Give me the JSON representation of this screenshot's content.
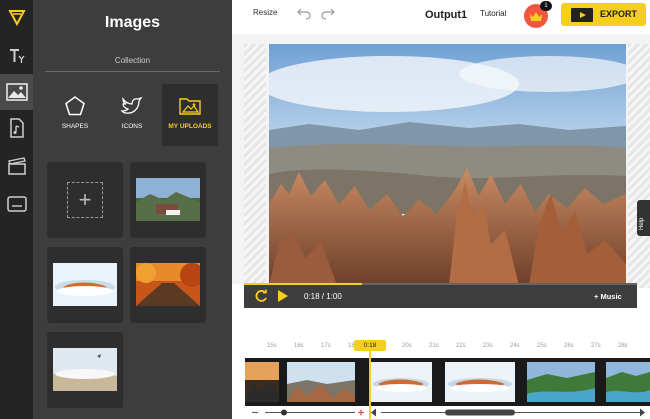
{
  "panel": {
    "title": "Images",
    "subtitle": "Collection",
    "categories": [
      {
        "label": "SHAPES"
      },
      {
        "label": "ICONS"
      },
      {
        "label": "MY UPLOADS"
      }
    ]
  },
  "topbar": {
    "resize": "Resize",
    "project": "Output1",
    "tutorial": "Tutorial",
    "badge": "1",
    "export": "EXPORT"
  },
  "player": {
    "time": "0:18 / 1:00",
    "music": "+ Music",
    "progress": 0.3
  },
  "help": "Help",
  "timeline": {
    "playhead_label": "0:18",
    "ticks": [
      "15s",
      "16s",
      "17s",
      "18s",
      "19s",
      "20s",
      "21s",
      "22s",
      "23s",
      "24s",
      "25s",
      "26s",
      "27s",
      "28s"
    ]
  },
  "colors": {
    "accent": "#f5cf1d",
    "dark": "#3d3d3d",
    "rail": "#242424",
    "crown": "#f0553f"
  }
}
